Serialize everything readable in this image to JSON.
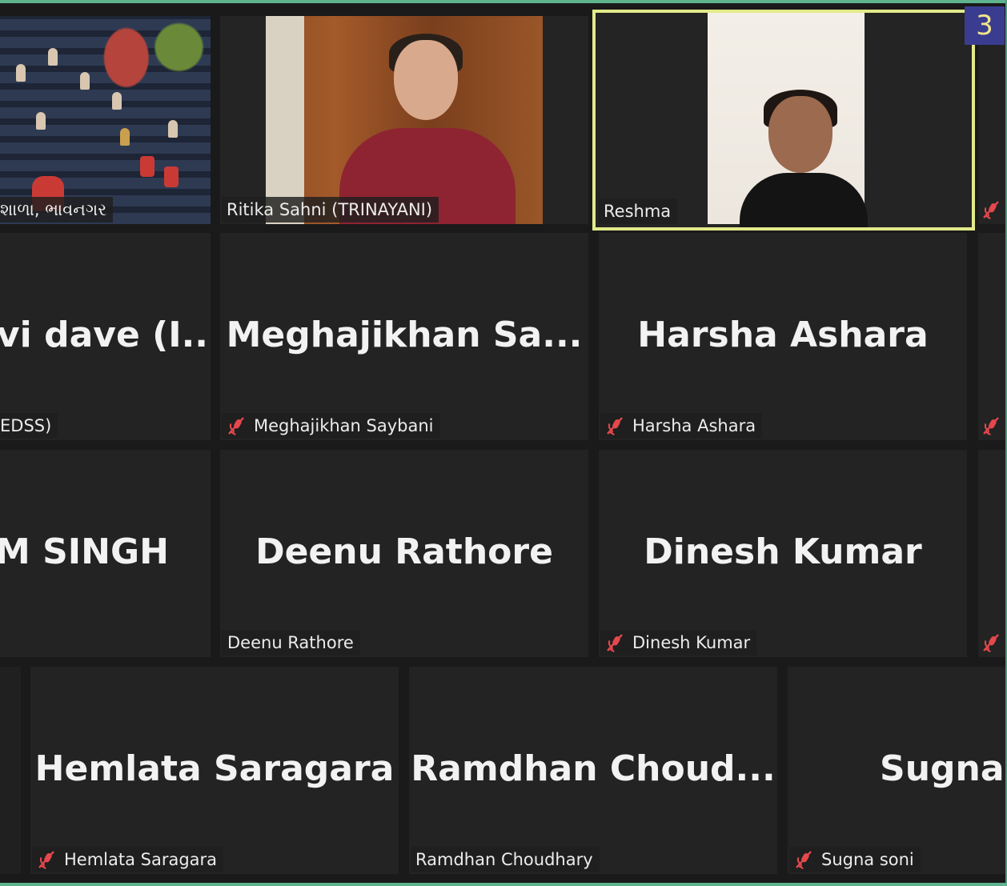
{
  "page_count_badge": "3",
  "colors": {
    "mute_red": "#e5484d",
    "active_speaker_border": "#e2ea8a",
    "badge_bg": "#3a3d8f",
    "badge_text": "#f3e58b",
    "frame_green": "#5fb38f"
  },
  "row1": {
    "tile_a": {
      "label": "શાળા, ભાવનગર",
      "muted": false
    },
    "tile_b": {
      "label": "Ritika Sahni (TRINAYANI)",
      "muted": false
    },
    "tile_c": {
      "label": "Reshma",
      "muted": false,
      "active_speaker": true
    }
  },
  "row2": {
    "tile_a": {
      "big_name": "vi  dave  (I...",
      "label": "EDSS)"
    },
    "tile_b": {
      "big_name": "Meghajikhan  Sa...",
      "label": "Meghajikhan Saybani",
      "muted": true
    },
    "tile_c": {
      "big_name": "Harsha Ashara",
      "label": "Harsha Ashara",
      "muted": true
    }
  },
  "row3": {
    "tile_a": {
      "big_name": "M SINGH"
    },
    "tile_b": {
      "big_name": "Deenu Rathore",
      "label": "Deenu Rathore",
      "muted": false
    },
    "tile_c": {
      "big_name": "Dinesh Kumar",
      "label": "Dinesh Kumar",
      "muted": true
    }
  },
  "row4": {
    "tile_a": {
      "big_name": "Hemlata Saragara",
      "label": "Hemlata Saragara",
      "muted": true
    },
    "tile_b": {
      "big_name": "Ramdhan  Choud...",
      "label": "Ramdhan Choudhary",
      "muted": false
    },
    "tile_c": {
      "big_name": "Sugna s",
      "label": "Sugna soni",
      "muted": true
    }
  },
  "icons": {
    "mute": "microphone-muted-icon"
  }
}
